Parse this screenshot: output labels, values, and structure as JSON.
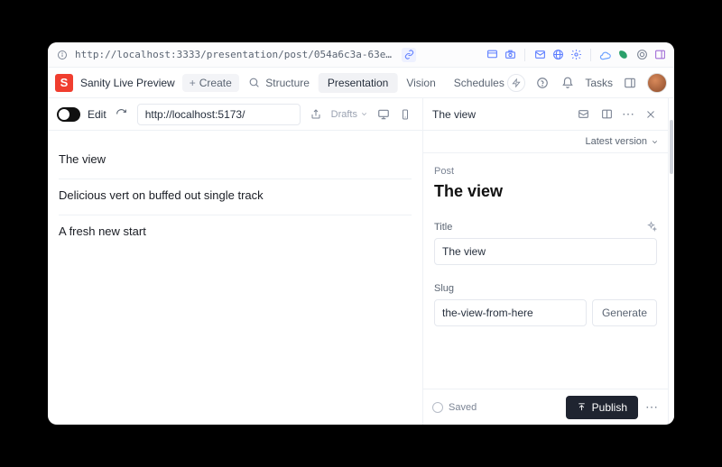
{
  "browser": {
    "url": "http://localhost:3333/presentation/post/054a6c3a-63e8-42b2-aafa-3969bc9f8b88?previ…"
  },
  "app": {
    "brand": "Sanity Live Preview",
    "create_label": "Create",
    "tabs": [
      "Structure",
      "Presentation",
      "Vision",
      "Schedules"
    ],
    "active_tab_index": 1,
    "tasks_label": "Tasks"
  },
  "preview": {
    "edit_label": "Edit",
    "url": "http://localhost:5173/",
    "drafts_label": "Drafts",
    "posts": [
      "The view",
      "Delicious vert on buffed out single track",
      "A fresh new start"
    ]
  },
  "doc": {
    "pane_title": "The view",
    "version_label": "Latest version",
    "type_label": "Post",
    "heading": "The view",
    "fields": {
      "title": {
        "label": "Title",
        "value": "The view"
      },
      "slug": {
        "label": "Slug",
        "value": "the-view-from-here",
        "generate_label": "Generate"
      }
    },
    "saved_label": "Saved",
    "publish_label": "Publish"
  }
}
